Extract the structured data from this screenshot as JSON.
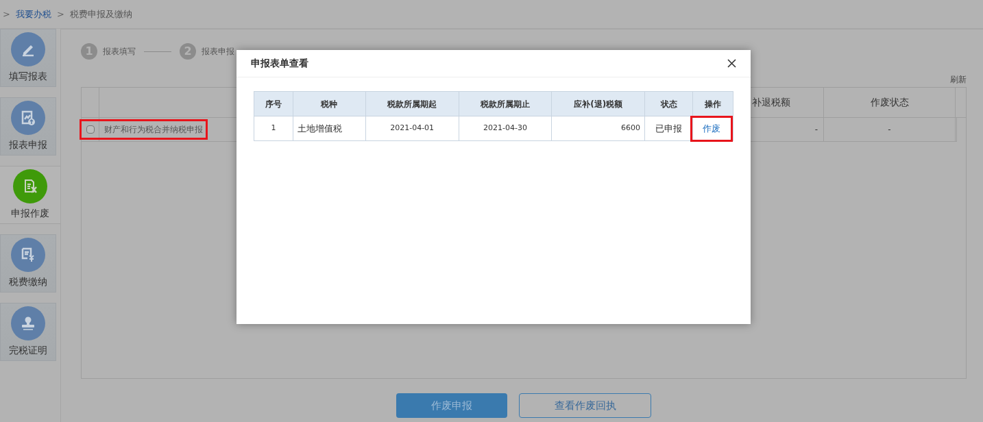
{
  "breadcrumb": {
    "separator": ">",
    "items": [
      {
        "label": "我要办税",
        "kind": "link"
      },
      {
        "label": "税费申报及缴纳",
        "kind": "text"
      }
    ]
  },
  "sidebar": {
    "items": [
      {
        "label": "填写报表",
        "kind": "pencil",
        "selected": false
      },
      {
        "label": "报表申报",
        "kind": "upload",
        "selected": false
      },
      {
        "label": "申报作废",
        "kind": "void",
        "selected": true
      },
      {
        "label": "税费缴纳",
        "kind": "pay",
        "selected": false
      },
      {
        "label": "完税证明",
        "kind": "stamp",
        "selected": false
      }
    ]
  },
  "steps": [
    {
      "number": "1",
      "label": "报表填写"
    },
    {
      "number": "2",
      "label": "报表申报"
    }
  ],
  "refresh_link": "刷新",
  "table": {
    "columns": [
      "补退税额",
      "作废状态"
    ],
    "rows": [
      {
        "checked": false,
        "name": "财产和行为税合并纳税申报",
        "highlighted": true,
        "cells": [
          "-",
          "-"
        ]
      }
    ]
  },
  "buttons": [
    {
      "label": "作废申报",
      "kind": "primary"
    },
    {
      "label": "查看作废回执",
      "kind": "outline"
    }
  ],
  "dialog": {
    "title": "申报表单查看",
    "columns": [
      "序号",
      "税种",
      "税款所属期起",
      "税款所属期止",
      "应补(退)税额",
      "状态",
      "操作"
    ],
    "rows": [
      {
        "index": "1",
        "tax_type": "土地增值税",
        "start": "2021-04-01",
        "end": "2021-04-30",
        "amount": "6600",
        "status": "已申报",
        "action": "作废",
        "highlighted": true
      }
    ]
  }
}
